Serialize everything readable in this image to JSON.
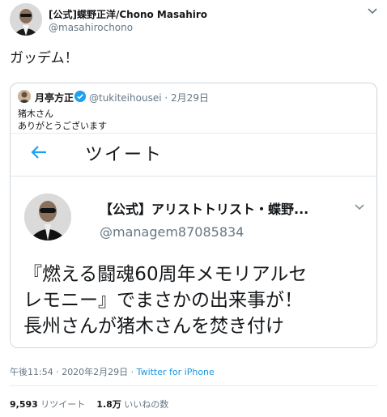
{
  "author": {
    "name": "[公式]蝶野正洋/Chono Masahiro",
    "handle": "@masahirochono"
  },
  "tweet_text": "ガッデム！",
  "quoted_tweet": {
    "name": "月亭方正",
    "handle": "@tukiteihousei",
    "date": "· 2月29日",
    "text_line1": "猪木さん",
    "text_line2": "ありがとうございます",
    "image": {
      "header_title": "ツイート",
      "account_name": "【公式】アリストトリスト・蝶野...",
      "account_handle": "@managem87085834",
      "body_line1": "『燃える闘魂60周年メモリアルセ",
      "body_line2": "レモニー』でまさかの出来事が！",
      "body_line3": "長州さんが猪木さんを焚き付け",
      "body_line4": "ー　　　　　　　　　　　　　"
    }
  },
  "meta": {
    "time_date": "午後11:54 · 2020年2月29日 · ",
    "source": "Twitter for iPhone"
  },
  "stats": {
    "retweets_count": "9,593",
    "retweets_label": "リツイート",
    "likes_count": "1.8万",
    "likes_label": "いいねの数"
  },
  "colors": {
    "accent": "#1da1f2",
    "link": "#1b95e0",
    "muted": "#657786"
  }
}
